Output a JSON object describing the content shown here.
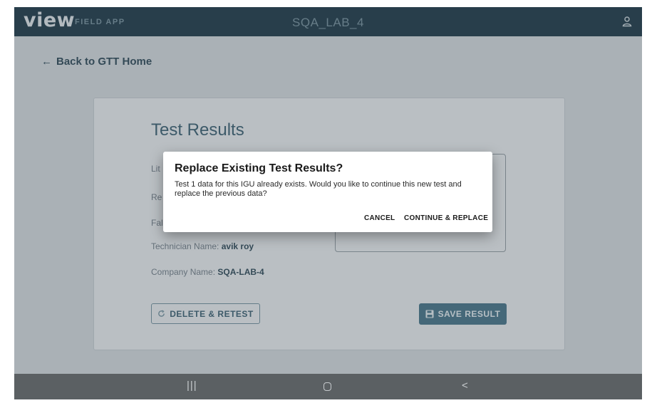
{
  "header": {
    "brand": "view",
    "brand_sub": "FIELD APP",
    "site": "SQA_LAB_4",
    "user_icon": "person-icon"
  },
  "nav": {
    "back_label": "Back to GTT Home"
  },
  "card": {
    "title": "Test Results",
    "fields": [
      {
        "label": "Lit"
      },
      {
        "label": "Re"
      },
      {
        "label": "Fal"
      },
      {
        "label": "Technician Name: ",
        "value": "avik roy"
      },
      {
        "label": "Company Name: ",
        "value": "SQA-LAB-4"
      }
    ],
    "delete_label": "DELETE & RETEST",
    "save_label": "SAVE RESULT"
  },
  "dialog": {
    "title": "Replace Existing Test Results?",
    "message": "Test 1 data for this IGU already exists. Would you like to continue this new test and replace the previous data?",
    "cancel_label": "CANCEL",
    "continue_label": "CONTINUE & REPLACE"
  },
  "android_nav": {
    "recents": "|||",
    "back": "<"
  }
}
